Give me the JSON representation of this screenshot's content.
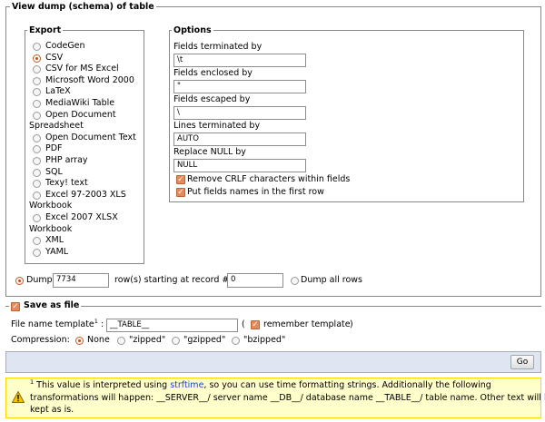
{
  "main_legend": "View dump (schema) of table",
  "export": {
    "legend": "Export",
    "formats": [
      {
        "label": "CodeGen",
        "checked": false
      },
      {
        "label": "CSV",
        "checked": true
      },
      {
        "label": "CSV for MS Excel",
        "checked": false
      },
      {
        "label": "Microsoft Word 2000",
        "checked": false
      },
      {
        "label": "LaTeX",
        "checked": false
      },
      {
        "label": "MediaWiki Table",
        "checked": false
      },
      {
        "label": "Open Document",
        "checked": false
      },
      {
        "label": "Spreadsheet",
        "wrap": true
      },
      {
        "label": "Open Document Text",
        "checked": false
      },
      {
        "label": "PDF",
        "checked": false
      },
      {
        "label": "PHP array",
        "checked": false
      },
      {
        "label": "SQL",
        "checked": false
      },
      {
        "label": "Texy! text",
        "checked": false
      },
      {
        "label": "Excel 97-2003 XLS",
        "checked": false
      },
      {
        "label": "Workbook",
        "wrap": true
      },
      {
        "label": "Excel 2007 XLSX",
        "checked": false
      },
      {
        "label": "Workbook",
        "wrap": true
      },
      {
        "label": "XML",
        "checked": false
      },
      {
        "label": "YAML",
        "checked": false
      }
    ]
  },
  "options": {
    "legend": "Options",
    "fields_terminated_label": "Fields terminated by",
    "fields_terminated_value": "\\t",
    "fields_enclosed_label": "Fields enclosed by",
    "fields_enclosed_value": "\"",
    "fields_escaped_label": "Fields escaped by",
    "fields_escaped_value": "\\",
    "lines_terminated_label": "Lines terminated by",
    "lines_terminated_value": "AUTO",
    "replace_null_label": "Replace NULL by",
    "replace_null_value": "NULL",
    "remove_crlf_label": "Remove CRLF characters within fields",
    "put_fields_label": "Put fields names in the first row"
  },
  "dump": {
    "dump_label": "Dump",
    "rows_value": "7734",
    "rows_text": "row(s) starting at record #",
    "start_value": "0",
    "dump_all_label": "Dump all rows"
  },
  "save": {
    "legend": "Save as file",
    "template_label": "File name template",
    "footnote_mark": "1",
    "template_colon": ":",
    "template_value": "__TABLE__",
    "paren_open": "(",
    "remember_label": "remember template",
    "paren_close": ")",
    "compression_label": "Compression:",
    "compression_options": [
      "None",
      "\"zipped\"",
      "\"gzipped\"",
      "\"bzipped\""
    ]
  },
  "go_label": "Go",
  "notice": {
    "mark": "1",
    "text_before": " This value is interpreted using ",
    "link": "strftime",
    "line1_rest": ", so you can use time formatting strings. Additionally the following",
    "line2": "transformations will happen: __SERVER__/ server name __DB__/ database name __TABLE__/ table name. Other text will be",
    "line3": "kept as is."
  },
  "colors": {
    "accent": "#d4441b",
    "footer_bg": "#dfe6f1",
    "notice_bg": "#ffffcc",
    "notice_border": "#ffd700"
  }
}
